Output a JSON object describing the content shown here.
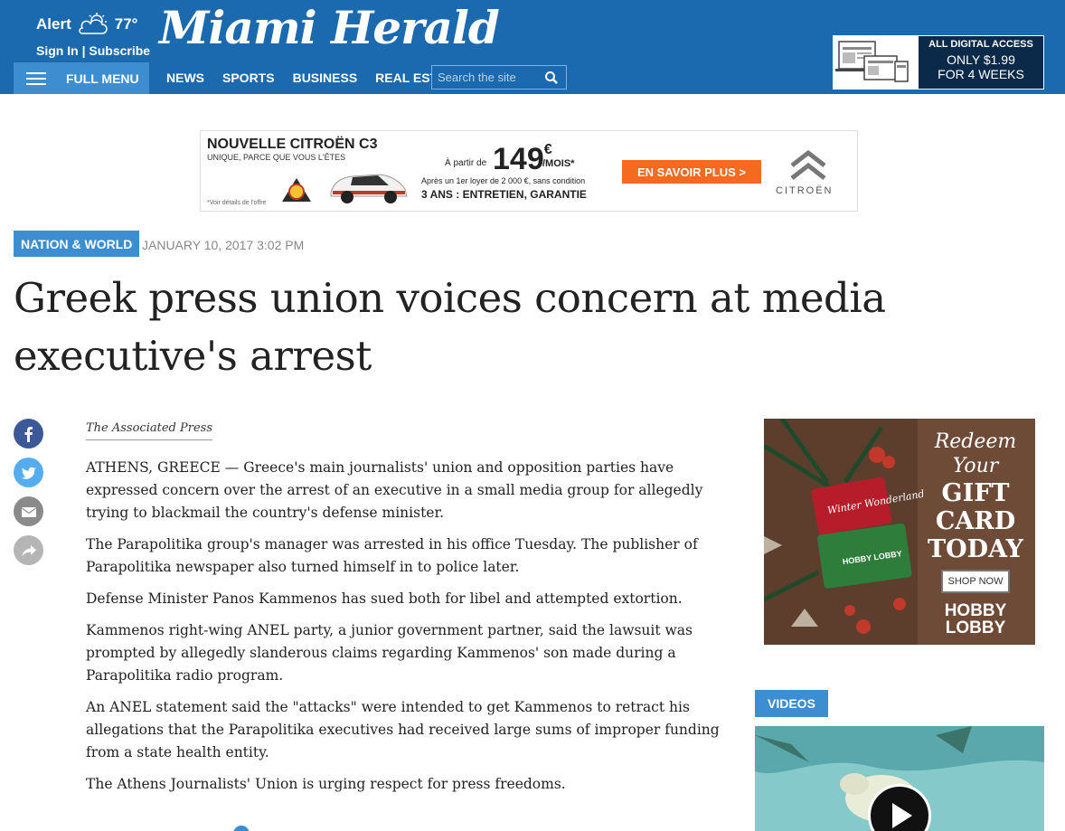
{
  "header": {
    "weather_alert": "Alert",
    "temperature": "77°",
    "sign_in": "Sign In",
    "separator": "|",
    "subscribe": "Subscribe",
    "logo": "Miami Herald",
    "full_menu": "FULL MENU",
    "nav": [
      "NEWS",
      "SPORTS",
      "BUSINESS",
      "REAL ESTATE"
    ],
    "search_placeholder": "Search the site",
    "promo": {
      "line1": "ALL DIGITAL ACCESS",
      "line2": "ONLY $1.99",
      "line3": "FOR 4 WEEKS"
    }
  },
  "ad_top": {
    "title": "NOUVELLE CITROËN C3",
    "subtitle": "UNIQUE, PARCE QUE VOUS L'ÊTES",
    "note": "*Voir détails de l'offre",
    "a_partir": "À partir de",
    "price": "149",
    "currency": "€",
    "per_month": "/MOIS*",
    "apres": "Après un 1er loyer de 2 000 €, sans condition",
    "ans": "3 ANS : ENTRETIEN, GARANTIE",
    "cta": "EN SAVOIR PLUS >",
    "brand": "CITROËN"
  },
  "article": {
    "section": "NATION & WORLD",
    "date": "JANUARY 10, 2017 3:02 PM",
    "headline": "Greek press union voices concern at media executive's arrest",
    "byline": "The Associated Press",
    "paragraphs": [
      "ATHENS, GREECE — Greece's main journalists' union and opposition parties have expressed concern over the arrest of an executive in a small media group for allegedly trying to blackmail the country's defense minister.",
      "The Parapolitika group's manager was arrested in his office Tuesday. The publisher of Parapolitika newspaper also turned himself in to police later.",
      "Defense Minister Panos Kammenos has sued both for libel and attempted extortion.",
      "Kammenos right-wing ANEL party, a junior government partner, said the lawsuit was prompted by allegedly slanderous claims regarding Kammenos' son made during a Parapolitika radio program.",
      "An ANEL statement said the \"attacks\" were intended to get Kammenos to retract his allegations that the Parapolitika executives had received large sums of improper funding from a state health entity.",
      "The Athens Journalists' Union is urging respect for press freedoms."
    ]
  },
  "share": [
    {
      "name": "facebook-icon",
      "color": "#3b5998"
    },
    {
      "name": "twitter-icon",
      "color": "#55acee"
    },
    {
      "name": "email-icon",
      "color": "#8a8a8a"
    },
    {
      "name": "share-icon",
      "color": "#b5b5b5"
    }
  ],
  "ad_right": {
    "line1": "Redeem",
    "line2": "Your",
    "line3": "GIFT",
    "line4": "CARD",
    "line5": "TODAY",
    "cta": "SHOP NOW",
    "brand1": "HOBBY",
    "brand2": "LOBBY",
    "card_text": "Winter Wonderland",
    "card_brand": "HOBBY LOBBY"
  },
  "videos": {
    "label": "VIDEOS"
  },
  "colors": {
    "header_blue": "#1b6ab0",
    "accent_blue": "#3d8dd1",
    "cta_orange": "#f46b1f"
  }
}
